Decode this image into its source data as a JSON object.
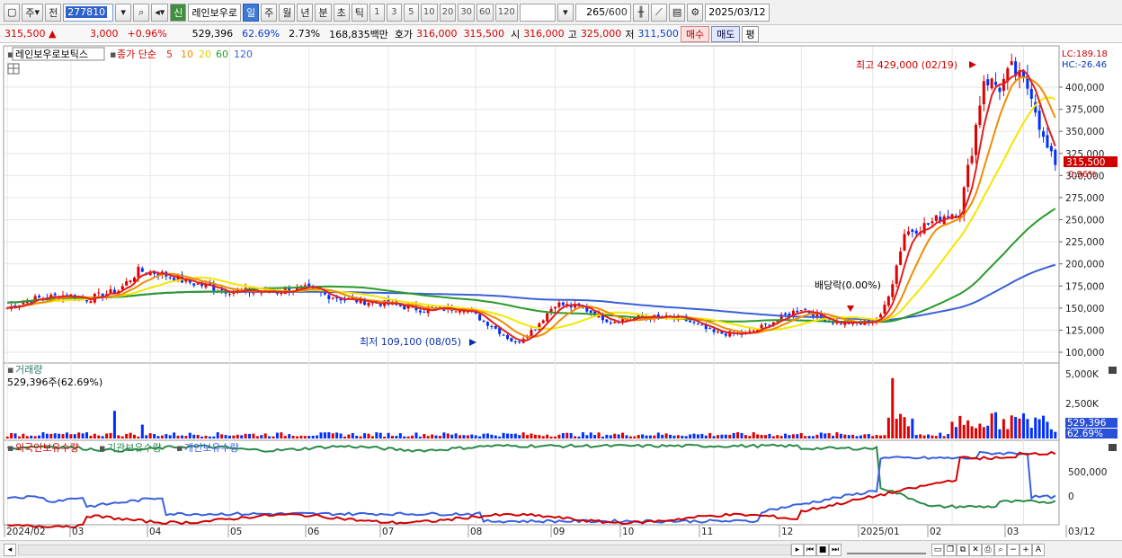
{
  "toolbar": {
    "market_select": "주",
    "prev_label": "전",
    "stock_code": "277810",
    "badge_new": "신",
    "stock_name_short": "레인보우로",
    "periods": [
      "일",
      "주",
      "월",
      "년",
      "분",
      "초",
      "틱"
    ],
    "selected_period": "일",
    "intervals": [
      "1",
      "3",
      "5",
      "10",
      "20",
      "30",
      "60",
      "120"
    ],
    "count": "265",
    "count_max": "/600",
    "date": "2025/03/12"
  },
  "quote": {
    "price": "315,500",
    "change": "3,000",
    "change_pct": "+0.96%",
    "volume": "529,396",
    "volume_ratio": "62.69%",
    "turnover": "2.73%",
    "amount": "168,835백만",
    "ask_label": "호가",
    "ask": "316,000",
    "bid": "315,500",
    "open_label": "시",
    "open": "316,000",
    "high_label": "고",
    "high": "325,000",
    "low_label": "저",
    "low": "311,500",
    "buy_label": "매수",
    "sell_label": "매도",
    "eval_label": "평"
  },
  "price_panel": {
    "stock_name": "레인보우로보틱스",
    "ma_label": "종가 단순",
    "ma_periods": [
      "5",
      "10",
      "20",
      "60",
      "120"
    ],
    "lc": "LC:189.18",
    "hc": "HC:-26.46",
    "high_annotation": "최고 429,000 (02/19)",
    "low_annotation": "최저 109,100 (08/05)",
    "dividend_annotation": "배당락(0.00%)",
    "current_price_tag": "315,500",
    "current_pct_tag": "0.96%",
    "y_ticks": [
      "400,000",
      "375,000",
      "350,000",
      "325,000",
      "300,000",
      "275,000",
      "250,000",
      "225,000",
      "200,000",
      "175,000",
      "150,000",
      "125,000",
      "100,000"
    ]
  },
  "volume_panel": {
    "title": "거래량",
    "info": "529,396주(62.69%)",
    "y_ticks": [
      "5,000K",
      "2,500K",
      "0"
    ],
    "tag_value": "529,396",
    "tag_pct": "62.69%"
  },
  "holdings_panel": {
    "series_labels": [
      "외국인보유수량",
      "기관보유수량",
      "개인보유수량"
    ],
    "y_ticks": [
      "500,000",
      "0"
    ]
  },
  "x_axis": [
    "2024/02",
    "03",
    "04",
    "05",
    "06",
    "07",
    "08",
    "09",
    "10",
    "11",
    "12",
    "2025/01",
    "02",
    "03",
    "03/12"
  ],
  "colors": {
    "ma5": "#e02020",
    "ma10": "#f08c00",
    "ma20": "#f5e600",
    "ma60": "#2a9a2a",
    "ma120": "#3a5fd8",
    "up": "#e00000",
    "down": "#0030ff",
    "foreign": "#d00000",
    "institution": "#2a8a4a",
    "individual": "#3a60e0"
  },
  "chart_data": {
    "type": "line",
    "title": "레인보우로보틱스",
    "x": [
      "2024/02",
      "03",
      "04",
      "05",
      "06",
      "07",
      "08",
      "09",
      "10",
      "11",
      "12",
      "2025/01",
      "02",
      "03"
    ],
    "series": [
      {
        "name": "5",
        "values": [
          155000,
          165000,
          195000,
          175000,
          165000,
          150000,
          120000,
          150000,
          138000,
          128000,
          135000,
          235000,
          400000,
          320000
        ]
      },
      {
        "name": "120",
        "values": [
          160000,
          163000,
          168000,
          170000,
          170000,
          168000,
          160000,
          150000,
          142000,
          140000,
          137000,
          140000,
          165000,
          200000
        ]
      }
    ],
    "annotations": [
      "최고 429,000 (02/19)",
      "최저 109,100 (08/05)"
    ],
    "ylim": [
      95000,
      435000
    ]
  }
}
